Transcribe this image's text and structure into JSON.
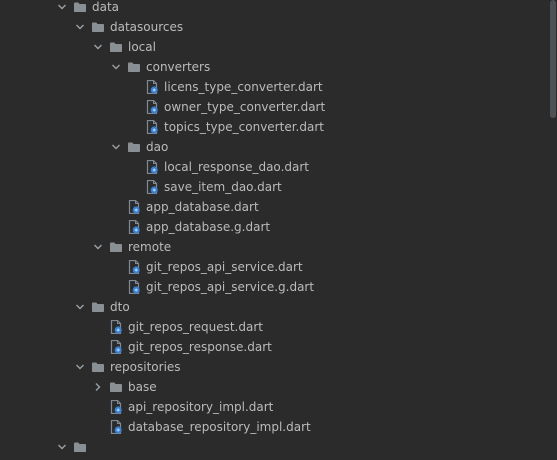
{
  "tree": [
    {
      "label": "data",
      "type": "folder",
      "depth": 0,
      "expanded": true
    },
    {
      "label": "datasources",
      "type": "folder",
      "depth": 1,
      "expanded": true
    },
    {
      "label": "local",
      "type": "folder",
      "depth": 2,
      "expanded": true
    },
    {
      "label": "converters",
      "type": "folder",
      "depth": 3,
      "expanded": true
    },
    {
      "label": "licens_type_converter.dart",
      "type": "dart",
      "depth": 4
    },
    {
      "label": "owner_type_converter.dart",
      "type": "dart",
      "depth": 4
    },
    {
      "label": "topics_type_converter.dart",
      "type": "dart",
      "depth": 4
    },
    {
      "label": "dao",
      "type": "folder",
      "depth": 3,
      "expanded": true
    },
    {
      "label": "local_response_dao.dart",
      "type": "dart",
      "depth": 4
    },
    {
      "label": "save_item_dao.dart",
      "type": "dart",
      "depth": 4
    },
    {
      "label": "app_database.dart",
      "type": "dart",
      "depth": 3
    },
    {
      "label": "app_database.g.dart",
      "type": "dart",
      "depth": 3
    },
    {
      "label": "remote",
      "type": "folder",
      "depth": 2,
      "expanded": true
    },
    {
      "label": "git_repos_api_service.dart",
      "type": "dart",
      "depth": 3
    },
    {
      "label": "git_repos_api_service.g.dart",
      "type": "dart",
      "depth": 3
    },
    {
      "label": "dto",
      "type": "folder",
      "depth": 1,
      "expanded": true
    },
    {
      "label": "git_repos_request.dart",
      "type": "dart",
      "depth": 2
    },
    {
      "label": "git_repos_response.dart",
      "type": "dart",
      "depth": 2
    },
    {
      "label": "repositories",
      "type": "folder",
      "depth": 1,
      "expanded": true
    },
    {
      "label": "base",
      "type": "folder",
      "depth": 2,
      "expanded": false
    },
    {
      "label": "api_repository_impl.dart",
      "type": "dart",
      "depth": 2
    },
    {
      "label": "database_repository_impl.dart",
      "type": "dart",
      "depth": 2
    },
    {
      "label": "",
      "type": "folder",
      "depth": 0,
      "expanded": true
    }
  ],
  "icons": {
    "chevron_expanded": "chevron-down-icon",
    "chevron_collapsed": "chevron-right-icon",
    "folder": "folder-icon",
    "dart": "dart-file-icon"
  },
  "colors": {
    "background": "#2b2b2b",
    "text": "#bbbbbb",
    "folder": "#8a8f94",
    "dart_file": "#7f8a94",
    "dart_badge": "#3a7fd0"
  }
}
